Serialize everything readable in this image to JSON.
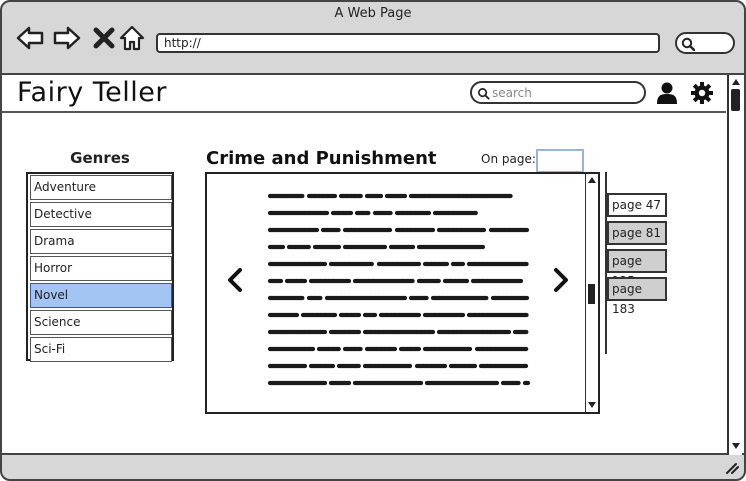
{
  "browser": {
    "title": "A Web Page",
    "url": "http://"
  },
  "header": {
    "app_title": "Fairy Teller",
    "search_placeholder": "search"
  },
  "genres": {
    "heading": "Genres",
    "items": [
      {
        "label": "Adventure",
        "selected": false
      },
      {
        "label": "Detective",
        "selected": false
      },
      {
        "label": "Drama",
        "selected": false
      },
      {
        "label": "Horror",
        "selected": false
      },
      {
        "label": "Novel",
        "selected": true
      },
      {
        "label": "Science",
        "selected": false
      },
      {
        "label": "Sci-Fi",
        "selected": false
      }
    ]
  },
  "book": {
    "title": "Crime and Punishment",
    "on_page_label": "On page:",
    "on_page_value": ""
  },
  "bookmarks": [
    {
      "label": "page 47",
      "active": true
    },
    {
      "label": "page 81",
      "active": false
    },
    {
      "label": "page 125",
      "active": false
    },
    {
      "label": "page 183",
      "active": false
    }
  ],
  "icons": {
    "back": "back-arrow-icon",
    "forward": "forward-arrow-icon",
    "stop": "close-icon",
    "home": "home-icon",
    "search": "search-icon",
    "user": "user-icon",
    "settings": "gear-icon",
    "prev": "chevron-left-icon",
    "next": "chevron-right-icon"
  },
  "colors": {
    "selected_item": "#a4c4f4",
    "chrome": "#d7d7d7",
    "bookmark_inactive": "#cfcfcf"
  }
}
